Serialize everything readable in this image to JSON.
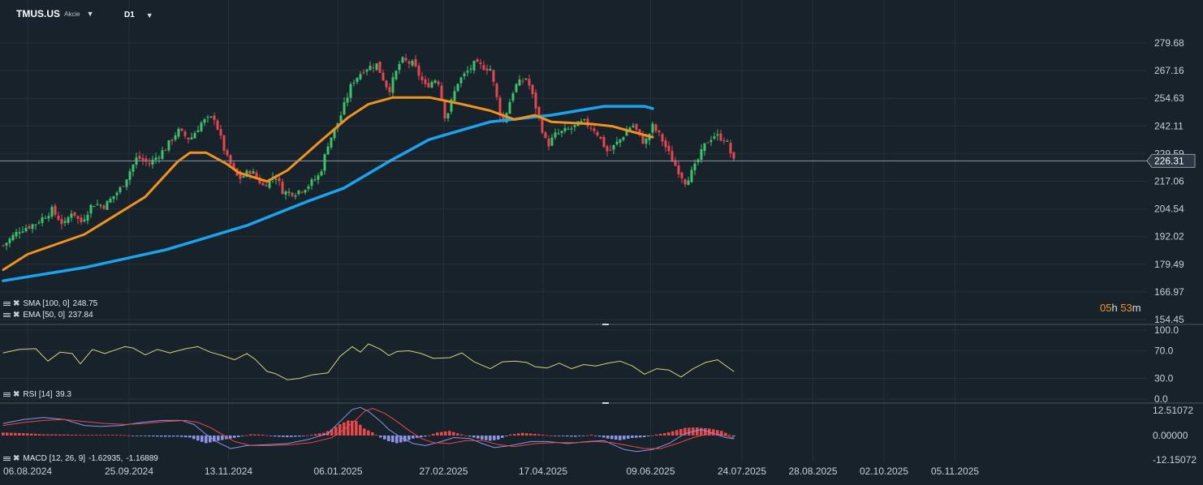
{
  "header": {
    "symbol": "TMUS.US",
    "instrument_type": "Akcie",
    "timeframe": "D1"
  },
  "indicators": {
    "sma": {
      "label": "SMA [100, 0]",
      "value": "248.75",
      "color": "#1aa3ee"
    },
    "ema": {
      "label": "EMA [50, 0]",
      "value": "237.84",
      "color": "#f0921e"
    },
    "rsi": {
      "label": "RSI [14]",
      "value": "39.3",
      "color": "#d6d27a"
    },
    "macd": {
      "label": "MACD [12, 26, 9]",
      "value1": "-1.62935,",
      "value2": "-1.16889",
      "macd_color": "#8d94e8",
      "signal_color": "#e84848"
    }
  },
  "countdown": {
    "h": "05",
    "h_unit": "h",
    "m": "53",
    "m_unit": "m"
  },
  "current_price": {
    "label": "226.31",
    "value": 226.31
  },
  "chart_data": [
    {
      "type": "candlestick",
      "up_color": "#3cc46a",
      "down_color": "#e8454f",
      "x_tick_labels": [
        "06.08.2024",
        "25.09.2024",
        "13.11.2024",
        "06.01.2025",
        "27.02.2025",
        "17.04.2025",
        "09.06.2025",
        "24.07.2025",
        "28.08.2025",
        "02.10.2025",
        "05.11.2025"
      ],
      "y_tick_labels": [
        "279.68",
        "267.16",
        "254.63",
        "242.11",
        "229.59",
        "217.06",
        "204.54",
        "192.02",
        "179.49",
        "166.97",
        "154.45"
      ],
      "ylim": [
        154.45,
        283.5
      ],
      "close_anchors": [
        [
          0,
          188
        ],
        [
          8,
          195
        ],
        [
          16,
          198
        ],
        [
          24,
          204
        ],
        [
          30,
          197
        ],
        [
          34,
          204
        ],
        [
          38,
          198
        ],
        [
          44,
          207
        ],
        [
          50,
          206
        ],
        [
          58,
          214
        ],
        [
          66,
          228
        ],
        [
          72,
          225
        ],
        [
          80,
          232
        ],
        [
          86,
          240
        ],
        [
          92,
          236
        ],
        [
          98,
          244
        ],
        [
          104,
          246
        ],
        [
          110,
          228
        ],
        [
          116,
          218
        ],
        [
          122,
          222
        ],
        [
          128,
          215
        ],
        [
          134,
          220
        ],
        [
          138,
          212
        ],
        [
          144,
          212
        ],
        [
          150,
          215
        ],
        [
          156,
          220
        ],
        [
          160,
          234
        ],
        [
          166,
          246
        ],
        [
          172,
          262
        ],
        [
          178,
          268
        ],
        [
          184,
          270
        ],
        [
          190,
          258
        ],
        [
          196,
          272
        ],
        [
          202,
          270
        ],
        [
          208,
          260
        ],
        [
          214,
          264
        ],
        [
          218,
          245
        ],
        [
          224,
          262
        ],
        [
          232,
          270
        ],
        [
          240,
          268
        ],
        [
          246,
          243
        ],
        [
          252,
          260
        ],
        [
          258,
          264
        ],
        [
          262,
          252
        ],
        [
          268,
          233
        ],
        [
          272,
          238
        ],
        [
          280,
          241
        ],
        [
          286,
          244
        ],
        [
          292,
          240
        ],
        [
          298,
          230
        ],
        [
          304,
          236
        ],
        [
          310,
          243
        ],
        [
          316,
          234
        ],
        [
          320,
          242
        ],
        [
          324,
          237
        ],
        [
          330,
          226
        ],
        [
          336,
          217
        ],
        [
          340,
          222
        ],
        [
          346,
          234
        ],
        [
          350,
          238
        ],
        [
          356,
          236
        ],
        [
          360,
          226
        ]
      ],
      "sma_100": [
        [
          0,
          172
        ],
        [
          40,
          178
        ],
        [
          80,
          186
        ],
        [
          120,
          197
        ],
        [
          150,
          208
        ],
        [
          168,
          214
        ],
        [
          190,
          226
        ],
        [
          210,
          236
        ],
        [
          240,
          244
        ],
        [
          270,
          247
        ],
        [
          296,
          251
        ],
        [
          306,
          251
        ],
        [
          316,
          251
        ],
        [
          320,
          250
        ]
      ],
      "ema_50": [
        [
          0,
          177
        ],
        [
          12,
          184
        ],
        [
          40,
          193
        ],
        [
          70,
          210
        ],
        [
          86,
          226
        ],
        [
          92,
          230
        ],
        [
          100,
          230
        ],
        [
          110,
          225
        ],
        [
          116,
          221
        ],
        [
          130,
          217
        ],
        [
          140,
          222
        ],
        [
          156,
          235
        ],
        [
          170,
          246
        ],
        [
          180,
          252
        ],
        [
          192,
          255
        ],
        [
          210,
          255
        ],
        [
          226,
          252
        ],
        [
          240,
          249
        ],
        [
          252,
          245
        ],
        [
          262,
          247
        ],
        [
          270,
          244
        ],
        [
          290,
          243
        ],
        [
          300,
          242
        ],
        [
          312,
          239
        ],
        [
          320,
          237
        ]
      ]
    },
    {
      "type": "line",
      "name": "RSI [14]",
      "y_tick_labels": [
        "100.0",
        "70.0",
        "30.0",
        "0.0"
      ],
      "ylim": [
        0,
        100
      ],
      "values": [
        [
          0,
          67
        ],
        [
          8,
          72
        ],
        [
          16,
          73
        ],
        [
          22,
          55
        ],
        [
          28,
          68
        ],
        [
          34,
          66
        ],
        [
          38,
          51
        ],
        [
          44,
          72
        ],
        [
          50,
          66
        ],
        [
          56,
          72
        ],
        [
          60,
          76
        ],
        [
          64,
          74
        ],
        [
          70,
          64
        ],
        [
          76,
          72
        ],
        [
          82,
          67
        ],
        [
          86,
          70
        ],
        [
          90,
          73
        ],
        [
          96,
          76
        ],
        [
          102,
          68
        ],
        [
          108,
          63
        ],
        [
          114,
          57
        ],
        [
          120,
          66
        ],
        [
          124,
          58
        ],
        [
          130,
          40
        ],
        [
          134,
          37
        ],
        [
          140,
          28
        ],
        [
          146,
          30
        ],
        [
          152,
          35
        ],
        [
          160,
          38
        ],
        [
          166,
          62
        ],
        [
          172,
          76
        ],
        [
          176,
          68
        ],
        [
          180,
          80
        ],
        [
          186,
          72
        ],
        [
          190,
          63
        ],
        [
          194,
          69
        ],
        [
          200,
          70
        ],
        [
          206,
          66
        ],
        [
          212,
          59
        ],
        [
          220,
          60
        ],
        [
          226,
          67
        ],
        [
          232,
          54
        ],
        [
          236,
          49
        ],
        [
          240,
          44
        ],
        [
          246,
          54
        ],
        [
          252,
          55
        ],
        [
          258,
          53
        ],
        [
          262,
          47
        ],
        [
          268,
          45
        ],
        [
          274,
          52
        ],
        [
          280,
          44
        ],
        [
          286,
          50
        ],
        [
          292,
          48
        ],
        [
          298,
          52
        ],
        [
          304,
          55
        ],
        [
          310,
          48
        ],
        [
          316,
          36
        ],
        [
          322,
          44
        ],
        [
          328,
          42
        ],
        [
          334,
          32
        ],
        [
          340,
          44
        ],
        [
          346,
          53
        ],
        [
          352,
          57
        ],
        [
          360,
          40
        ]
      ]
    },
    {
      "type": "histogram",
      "name": "MACD [12, 26, 9]",
      "y_tick_labels": [
        "12.51072",
        "0.00000",
        "-12.15072"
      ],
      "ylim": [
        -12.15072,
        12.51072
      ],
      "histogram": [
        [
          0,
          1.5
        ],
        [
          10,
          1.2
        ],
        [
          20,
          0.6
        ],
        [
          30,
          0.5
        ],
        [
          40,
          0.3
        ],
        [
          50,
          0.3
        ],
        [
          58,
          0.3
        ],
        [
          66,
          -0.2
        ],
        [
          72,
          -0.4
        ],
        [
          80,
          -0.6
        ],
        [
          86,
          -0.5
        ],
        [
          92,
          -1.0
        ],
        [
          96,
          -2.5
        ],
        [
          100,
          -3.8
        ],
        [
          104,
          -3.0
        ],
        [
          110,
          -1.8
        ],
        [
          116,
          -0.8
        ],
        [
          122,
          0.6
        ],
        [
          128,
          0.4
        ],
        [
          134,
          -0.5
        ],
        [
          140,
          -0.8
        ],
        [
          146,
          -0.5
        ],
        [
          152,
          0.4
        ],
        [
          158,
          1.4
        ],
        [
          162,
          3.0
        ],
        [
          166,
          5.6
        ],
        [
          170,
          7.5
        ],
        [
          174,
          7.2
        ],
        [
          178,
          3.5
        ],
        [
          182,
          1.6
        ],
        [
          186,
          -1.0
        ],
        [
          190,
          -2.8
        ],
        [
          194,
          -3.8
        ],
        [
          198,
          -3.0
        ],
        [
          202,
          -1.5
        ],
        [
          208,
          -0.5
        ],
        [
          214,
          1.5
        ],
        [
          220,
          2.3
        ],
        [
          226,
          0.5
        ],
        [
          232,
          -1.0
        ],
        [
          236,
          -2.0
        ],
        [
          240,
          -2.6
        ],
        [
          244,
          -2.0
        ],
        [
          250,
          0.5
        ],
        [
          256,
          1.3
        ],
        [
          262,
          0.8
        ],
        [
          268,
          0.2
        ],
        [
          274,
          -0.3
        ],
        [
          282,
          -0.6
        ],
        [
          290,
          0.4
        ],
        [
          298,
          -1.5
        ],
        [
          304,
          -2.3
        ],
        [
          310,
          -1.2
        ],
        [
          316,
          -0.8
        ],
        [
          322,
          0.5
        ],
        [
          328,
          1.6
        ],
        [
          336,
          3.8
        ],
        [
          342,
          4.0
        ],
        [
          348,
          3.5
        ],
        [
          354,
          2.3
        ],
        [
          360,
          -0.5
        ]
      ],
      "macd": [
        [
          0,
          6
        ],
        [
          10,
          8
        ],
        [
          20,
          9
        ],
        [
          30,
          8
        ],
        [
          40,
          5
        ],
        [
          48,
          4.5
        ],
        [
          58,
          5
        ],
        [
          68,
          6.5
        ],
        [
          78,
          7.5
        ],
        [
          88,
          7.5
        ],
        [
          94,
          5.5
        ],
        [
          100,
          0.5
        ],
        [
          106,
          -3.5
        ],
        [
          112,
          -6.5
        ],
        [
          120,
          -5
        ],
        [
          130,
          -4.5
        ],
        [
          140,
          -4
        ],
        [
          150,
          -2
        ],
        [
          160,
          1
        ],
        [
          166,
          7
        ],
        [
          172,
          13
        ],
        [
          176,
          14
        ],
        [
          180,
          12
        ],
        [
          186,
          7
        ],
        [
          190,
          3
        ],
        [
          196,
          -1
        ],
        [
          202,
          -4
        ],
        [
          208,
          -5
        ],
        [
          216,
          -3
        ],
        [
          222,
          -1
        ],
        [
          230,
          -1.5
        ],
        [
          236,
          -4
        ],
        [
          242,
          -6
        ],
        [
          250,
          -5
        ],
        [
          260,
          -3
        ],
        [
          268,
          -3
        ],
        [
          278,
          -4
        ],
        [
          288,
          -3
        ],
        [
          296,
          -2.5
        ],
        [
          306,
          -7
        ],
        [
          312,
          -8
        ],
        [
          320,
          -7
        ],
        [
          328,
          -4
        ],
        [
          336,
          1
        ],
        [
          344,
          3
        ],
        [
          350,
          1
        ],
        [
          356,
          -1
        ],
        [
          360,
          -1.6
        ]
      ],
      "signal": [
        [
          0,
          5
        ],
        [
          10,
          6.5
        ],
        [
          20,
          7.5
        ],
        [
          30,
          8
        ],
        [
          40,
          7
        ],
        [
          50,
          6
        ],
        [
          60,
          5.5
        ],
        [
          70,
          6
        ],
        [
          80,
          7
        ],
        [
          90,
          7.5
        ],
        [
          96,
          6.5
        ],
        [
          102,
          4
        ],
        [
          108,
          0.5
        ],
        [
          114,
          -3
        ],
        [
          122,
          -5
        ],
        [
          132,
          -5
        ],
        [
          142,
          -4.5
        ],
        [
          152,
          -3.5
        ],
        [
          162,
          -1
        ],
        [
          168,
          3
        ],
        [
          174,
          8
        ],
        [
          178,
          12
        ],
        [
          182,
          13.5
        ],
        [
          188,
          11
        ],
        [
          194,
          7
        ],
        [
          200,
          2.5
        ],
        [
          206,
          -1.5
        ],
        [
          212,
          -3.5
        ],
        [
          220,
          -4
        ],
        [
          228,
          -2.5
        ],
        [
          236,
          -2.5
        ],
        [
          244,
          -4.5
        ],
        [
          252,
          -5.5
        ],
        [
          262,
          -4
        ],
        [
          272,
          -3.5
        ],
        [
          282,
          -3.5
        ],
        [
          292,
          -3
        ],
        [
          300,
          -3.5
        ],
        [
          308,
          -5
        ],
        [
          316,
          -6.5
        ],
        [
          324,
          -6.5
        ],
        [
          332,
          -4
        ],
        [
          340,
          -1
        ],
        [
          348,
          1
        ],
        [
          354,
          0.5
        ],
        [
          360,
          -1.2
        ]
      ]
    }
  ]
}
